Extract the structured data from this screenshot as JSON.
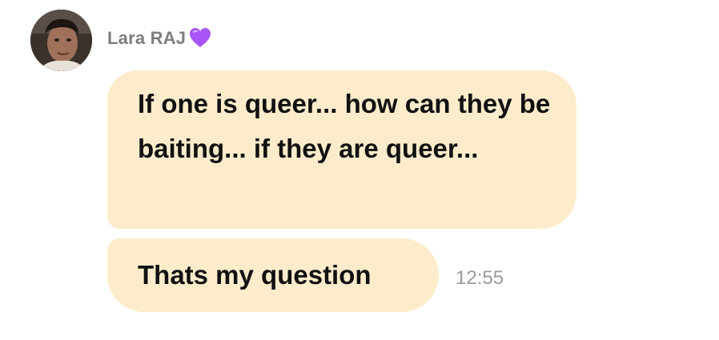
{
  "message_group": {
    "sender": {
      "name": "Lara RAJ",
      "badge_icon": "purple-heart-icon",
      "badge_color": "#a855f7"
    },
    "messages": [
      {
        "text": "If one is queer... how can they be baiting... if they are queer...",
        "background": "#fdeccb"
      },
      {
        "text": "Thats my question",
        "background": "#fdeccb",
        "time": "12:55"
      }
    ]
  }
}
